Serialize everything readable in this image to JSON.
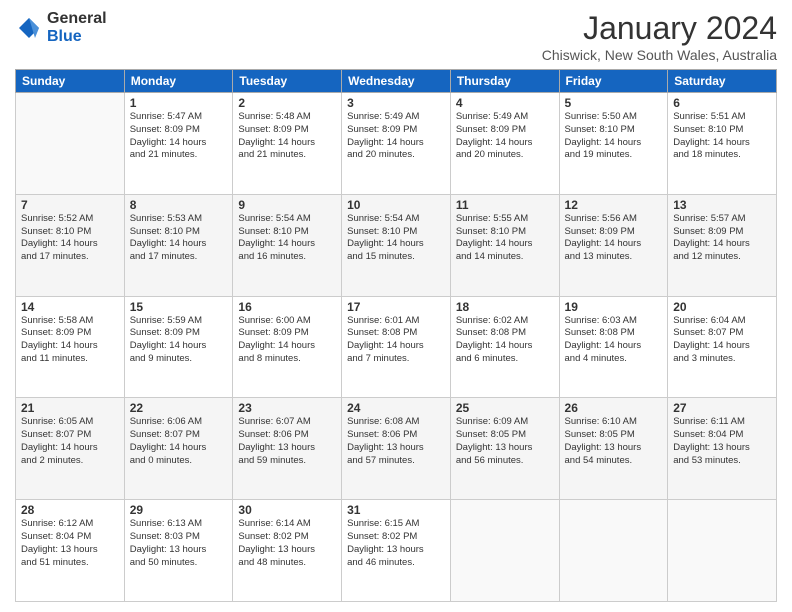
{
  "logo": {
    "general": "General",
    "blue": "Blue"
  },
  "title": "January 2024",
  "subtitle": "Chiswick, New South Wales, Australia",
  "days_of_week": [
    "Sunday",
    "Monday",
    "Tuesday",
    "Wednesday",
    "Thursday",
    "Friday",
    "Saturday"
  ],
  "weeks": [
    [
      {
        "day": "",
        "info": ""
      },
      {
        "day": "1",
        "info": "Sunrise: 5:47 AM\nSunset: 8:09 PM\nDaylight: 14 hours\nand 21 minutes."
      },
      {
        "day": "2",
        "info": "Sunrise: 5:48 AM\nSunset: 8:09 PM\nDaylight: 14 hours\nand 21 minutes."
      },
      {
        "day": "3",
        "info": "Sunrise: 5:49 AM\nSunset: 8:09 PM\nDaylight: 14 hours\nand 20 minutes."
      },
      {
        "day": "4",
        "info": "Sunrise: 5:49 AM\nSunset: 8:09 PM\nDaylight: 14 hours\nand 20 minutes."
      },
      {
        "day": "5",
        "info": "Sunrise: 5:50 AM\nSunset: 8:10 PM\nDaylight: 14 hours\nand 19 minutes."
      },
      {
        "day": "6",
        "info": "Sunrise: 5:51 AM\nSunset: 8:10 PM\nDaylight: 14 hours\nand 18 minutes."
      }
    ],
    [
      {
        "day": "7",
        "info": "Sunrise: 5:52 AM\nSunset: 8:10 PM\nDaylight: 14 hours\nand 17 minutes."
      },
      {
        "day": "8",
        "info": "Sunrise: 5:53 AM\nSunset: 8:10 PM\nDaylight: 14 hours\nand 17 minutes."
      },
      {
        "day": "9",
        "info": "Sunrise: 5:54 AM\nSunset: 8:10 PM\nDaylight: 14 hours\nand 16 minutes."
      },
      {
        "day": "10",
        "info": "Sunrise: 5:54 AM\nSunset: 8:10 PM\nDaylight: 14 hours\nand 15 minutes."
      },
      {
        "day": "11",
        "info": "Sunrise: 5:55 AM\nSunset: 8:10 PM\nDaylight: 14 hours\nand 14 minutes."
      },
      {
        "day": "12",
        "info": "Sunrise: 5:56 AM\nSunset: 8:09 PM\nDaylight: 14 hours\nand 13 minutes."
      },
      {
        "day": "13",
        "info": "Sunrise: 5:57 AM\nSunset: 8:09 PM\nDaylight: 14 hours\nand 12 minutes."
      }
    ],
    [
      {
        "day": "14",
        "info": "Sunrise: 5:58 AM\nSunset: 8:09 PM\nDaylight: 14 hours\nand 11 minutes."
      },
      {
        "day": "15",
        "info": "Sunrise: 5:59 AM\nSunset: 8:09 PM\nDaylight: 14 hours\nand 9 minutes."
      },
      {
        "day": "16",
        "info": "Sunrise: 6:00 AM\nSunset: 8:09 PM\nDaylight: 14 hours\nand 8 minutes."
      },
      {
        "day": "17",
        "info": "Sunrise: 6:01 AM\nSunset: 8:08 PM\nDaylight: 14 hours\nand 7 minutes."
      },
      {
        "day": "18",
        "info": "Sunrise: 6:02 AM\nSunset: 8:08 PM\nDaylight: 14 hours\nand 6 minutes."
      },
      {
        "day": "19",
        "info": "Sunrise: 6:03 AM\nSunset: 8:08 PM\nDaylight: 14 hours\nand 4 minutes."
      },
      {
        "day": "20",
        "info": "Sunrise: 6:04 AM\nSunset: 8:07 PM\nDaylight: 14 hours\nand 3 minutes."
      }
    ],
    [
      {
        "day": "21",
        "info": "Sunrise: 6:05 AM\nSunset: 8:07 PM\nDaylight: 14 hours\nand 2 minutes."
      },
      {
        "day": "22",
        "info": "Sunrise: 6:06 AM\nSunset: 8:07 PM\nDaylight: 14 hours\nand 0 minutes."
      },
      {
        "day": "23",
        "info": "Sunrise: 6:07 AM\nSunset: 8:06 PM\nDaylight: 13 hours\nand 59 minutes."
      },
      {
        "day": "24",
        "info": "Sunrise: 6:08 AM\nSunset: 8:06 PM\nDaylight: 13 hours\nand 57 minutes."
      },
      {
        "day": "25",
        "info": "Sunrise: 6:09 AM\nSunset: 8:05 PM\nDaylight: 13 hours\nand 56 minutes."
      },
      {
        "day": "26",
        "info": "Sunrise: 6:10 AM\nSunset: 8:05 PM\nDaylight: 13 hours\nand 54 minutes."
      },
      {
        "day": "27",
        "info": "Sunrise: 6:11 AM\nSunset: 8:04 PM\nDaylight: 13 hours\nand 53 minutes."
      }
    ],
    [
      {
        "day": "28",
        "info": "Sunrise: 6:12 AM\nSunset: 8:04 PM\nDaylight: 13 hours\nand 51 minutes."
      },
      {
        "day": "29",
        "info": "Sunrise: 6:13 AM\nSunset: 8:03 PM\nDaylight: 13 hours\nand 50 minutes."
      },
      {
        "day": "30",
        "info": "Sunrise: 6:14 AM\nSunset: 8:02 PM\nDaylight: 13 hours\nand 48 minutes."
      },
      {
        "day": "31",
        "info": "Sunrise: 6:15 AM\nSunset: 8:02 PM\nDaylight: 13 hours\nand 46 minutes."
      },
      {
        "day": "",
        "info": ""
      },
      {
        "day": "",
        "info": ""
      },
      {
        "day": "",
        "info": ""
      }
    ]
  ]
}
